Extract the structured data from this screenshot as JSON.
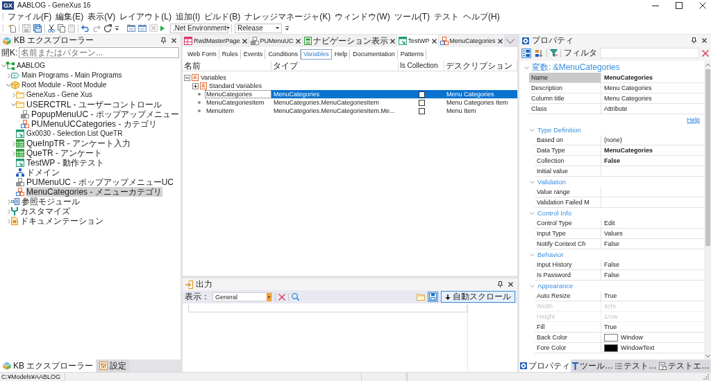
{
  "window": {
    "app_icon": "GX",
    "title": "AABLOG - GeneXus 16"
  },
  "menu": [
    "ファイル(F)",
    "編集(E)",
    "表示(V)",
    "レイアウト(L)",
    "追加(I)",
    "ビルド(B)",
    "ナレッジマネージャ(K)",
    "ウィンドウ(W)",
    "ツール(T)",
    "テスト",
    "ヘルプ(H)"
  ],
  "toolbar": {
    "groups": [
      [
        {
          "kind": "new",
          "disabled": false
        }
      ],
      [
        {
          "kind": "save",
          "disabled": true
        },
        {
          "kind": "save-all",
          "disabled": false
        }
      ],
      [
        {
          "kind": "cut",
          "disabled": false
        },
        {
          "kind": "copy",
          "disabled": false
        },
        {
          "kind": "paste",
          "disabled": true
        }
      ],
      [
        {
          "kind": "undo",
          "disabled": false
        },
        {
          "kind": "redo",
          "disabled": true
        },
        {
          "kind": "refresh",
          "disabled": false
        }
      ]
    ],
    "build_buttons": [
      {
        "kind": "build-all",
        "disabled": false
      },
      {
        "kind": "build",
        "disabled": false
      },
      {
        "kind": "cancel",
        "disabled": true
      },
      {
        "kind": "run",
        "disabled": false
      }
    ],
    "environment": ".Net Environment",
    "configuration": "Release"
  },
  "kb_explorer": {
    "title": "KB エクスプローラー",
    "search_label": "開K:",
    "search_placeholder": "名前またはパターン...",
    "tree": [
      {
        "label": "AABLOG",
        "kind": "kb",
        "expanded": true,
        "selected": false,
        "children": [
          {
            "label": "Main Programs - Main Programs",
            "kind": "main-programs",
            "expanded": false,
            "selected": false
          },
          {
            "label": "Root Module - Root Module",
            "kind": "module",
            "expanded": true,
            "selected": false,
            "children": [
              {
                "label": "GeneXus - Gene Xus",
                "kind": "folder",
                "expanded": false,
                "selected": false
              },
              {
                "label": "USERCTRL - ユーザーコントロール",
                "kind": "folder",
                "expanded": true,
                "selected": false,
                "children": [
                  {
                    "label": "PopupMenuUC - ポップアップメニュー",
                    "kind": "user-control",
                    "selected": false
                  },
                  {
                    "label": "PUMenuUCCategories - カテゴリ",
                    "kind": "sdt",
                    "selected": false
                  }
                ]
              },
              {
                "label": "Gx0030 - Selection List QueTR",
                "kind": "web-panel",
                "selected": false
              },
              {
                "label": "QueInpTR - アンケート入力",
                "kind": "transaction",
                "expanded": false,
                "selected": false
              },
              {
                "label": "QueTR - アンケート",
                "kind": "transaction",
                "expanded": false,
                "selected": false
              },
              {
                "label": "TestWP - 動作テスト",
                "kind": "web-panel",
                "selected": false
              },
              {
                "label": "ドメイン",
                "kind": "domain",
                "selected": false
              },
              {
                "label": "PUMenuUC - ポップアップメニューUC",
                "kind": "user-control",
                "selected": false
              },
              {
                "label": "MenuCategories - メニューカテゴリ",
                "kind": "sdt",
                "selected": true
              }
            ]
          },
          {
            "label": "参照モジュール",
            "kind": "references",
            "expanded": false,
            "selected": false
          },
          {
            "label": "カスタマイズ",
            "kind": "customize",
            "expanded": false,
            "selected": false
          },
          {
            "label": "ドキュメンテーション",
            "kind": "documentation",
            "expanded": false,
            "selected": false
          }
        ]
      }
    ]
  },
  "left_tabs": [
    {
      "label": "KB エクスプローラー",
      "kind": "kb-explorer",
      "selected": true
    },
    {
      "label": "設定",
      "kind": "settings",
      "selected": false
    }
  ],
  "document_tabs": [
    {
      "label": "RwdMasterPage",
      "kind": "master-page",
      "selected": false
    },
    {
      "label": "PUMenuUC",
      "kind": "user-control",
      "selected": false
    },
    {
      "label": "ナビゲーション表示",
      "kind": "navigation",
      "selected": false
    },
    {
      "label": "TestWP",
      "kind": "web-panel",
      "selected": true
    },
    {
      "label": "MenuCategories",
      "kind": "sdt",
      "selected": false
    }
  ],
  "editor_tabs": [
    {
      "label": "Web Form",
      "selected": false
    },
    {
      "label": "Rules",
      "selected": false
    },
    {
      "label": "Events",
      "selected": false
    },
    {
      "label": "Conditions",
      "selected": false
    },
    {
      "label": "Variables",
      "selected": true
    },
    {
      "label": "Help",
      "selected": false
    },
    {
      "label": "Documentation",
      "selected": false
    },
    {
      "label": "Patterns",
      "selected": false
    }
  ],
  "variables": {
    "columns": [
      "名前",
      "タイプ",
      "Is Collection",
      "デスクリプション"
    ],
    "tree": [
      {
        "kind": "group",
        "label": "Variables",
        "badge": "&",
        "expanded": true,
        "selected": false,
        "children": [
          {
            "kind": "group",
            "label": "Standard Variables",
            "badge": "&",
            "expanded": false,
            "selected": false
          },
          {
            "kind": "variable",
            "name": "MenuCategories",
            "type": "MenuCategories",
            "is_collection": false,
            "description": "Menu Categories",
            "selected": true
          },
          {
            "kind": "variable",
            "name": "MenuCategoriesItem",
            "type": "MenuCategories.MenuCategoriesItem",
            "is_collection": false,
            "description": "Menu Categories Item",
            "selected": false
          },
          {
            "kind": "variable",
            "name": "MenuItem",
            "type": "MenuCategories.MenuCategoriesItem.Me...",
            "is_collection": false,
            "description": "Menu Item",
            "selected": false
          }
        ]
      }
    ]
  },
  "output": {
    "title": "出力",
    "filter_label": "表示：",
    "filter_value": "General",
    "save_pressed": true,
    "autoscroll": {
      "label": "自動スクロール",
      "pressed": true
    }
  },
  "properties": {
    "title": "プロパティ",
    "categorized": true,
    "filter_label": "フィルタ",
    "object": {
      "label": "変数: &MenuCategories",
      "expanded": true,
      "rows": [
        {
          "name": "Name",
          "value": "MenuCategories",
          "bold": true,
          "disabled": false,
          "selected": true
        },
        {
          "name": "Description",
          "value": "Menu Categories",
          "bold": false,
          "disabled": false,
          "selected": false
        },
        {
          "name": "Column title",
          "value": "Menu Categories",
          "bold": false,
          "disabled": false,
          "selected": false
        },
        {
          "name": "Class",
          "value": "Attribute",
          "bold": false,
          "disabled": false,
          "selected": false
        }
      ]
    },
    "help_link": "Help",
    "categories": [
      {
        "title": "Type Definition",
        "expanded": true,
        "rows": [
          {
            "name": "Based on",
            "value": "(none)",
            "bold": false,
            "disabled": false,
            "selected": false
          },
          {
            "name": "Data Type",
            "value": "MenuCategories",
            "bold": true,
            "disabled": false,
            "selected": false
          },
          {
            "name": "Collection",
            "value": "False",
            "bold": true,
            "disabled": false,
            "selected": false
          },
          {
            "name": "Initial value",
            "disabled": false,
            "selected": false
          }
        ]
      },
      {
        "title": "Validation",
        "expanded": true,
        "rows": [
          {
            "name": "Value range",
            "disabled": false,
            "selected": false
          },
          {
            "name": "Validation Failed M",
            "disabled": false,
            "selected": false
          }
        ]
      },
      {
        "title": "Control Info",
        "expanded": true,
        "rows": [
          {
            "name": "Control Type",
            "value": "Edit",
            "bold": false,
            "disabled": false,
            "selected": false
          },
          {
            "name": "Input Type",
            "value": "Values",
            "bold": false,
            "disabled": false,
            "selected": false
          },
          {
            "name": "Notify Context Ch",
            "value": "False",
            "bold": false,
            "disabled": false,
            "selected": false
          }
        ]
      },
      {
        "title": "Behavior",
        "expanded": true,
        "rows": [
          {
            "name": "Input History",
            "value": "False",
            "bold": false,
            "disabled": false,
            "selected": false
          },
          {
            "name": "Is Password",
            "value": "False",
            "bold": false,
            "disabled": false,
            "selected": false
          }
        ]
      },
      {
        "title": "Appearance",
        "expanded": true,
        "rows": [
          {
            "name": "Auto Resize",
            "value": "True",
            "bold": false,
            "disabled": false,
            "selected": false
          },
          {
            "name": "Width",
            "value": "4chr",
            "bold": false,
            "disabled": true,
            "selected": false
          },
          {
            "name": "Height",
            "value": "1row",
            "bold": false,
            "disabled": true,
            "selected": false
          },
          {
            "name": "Fill",
            "value": "True",
            "bold": false,
            "disabled": false,
            "selected": false
          },
          {
            "name": "Back Color",
            "value": "Window",
            "color": "#ffffff",
            "bold": false,
            "disabled": false,
            "selected": false
          },
          {
            "name": "Fore Color",
            "value": "WindowText",
            "color": "#000000",
            "bold": false,
            "disabled": false,
            "selected": false
          }
        ]
      }
    ]
  },
  "right_tabs": [
    {
      "label": "プロパティ",
      "kind": "properties",
      "selected": true
    },
    {
      "label": "ツール…",
      "kind": "toolbox",
      "selected": false
    },
    {
      "label": "テスト…",
      "kind": "test-list",
      "selected": false
    },
    {
      "label": "テストエ…",
      "kind": "test-explorer",
      "selected": false
    }
  ],
  "status_bar": {
    "path": "C:¥Models¥AABLOG"
  }
}
